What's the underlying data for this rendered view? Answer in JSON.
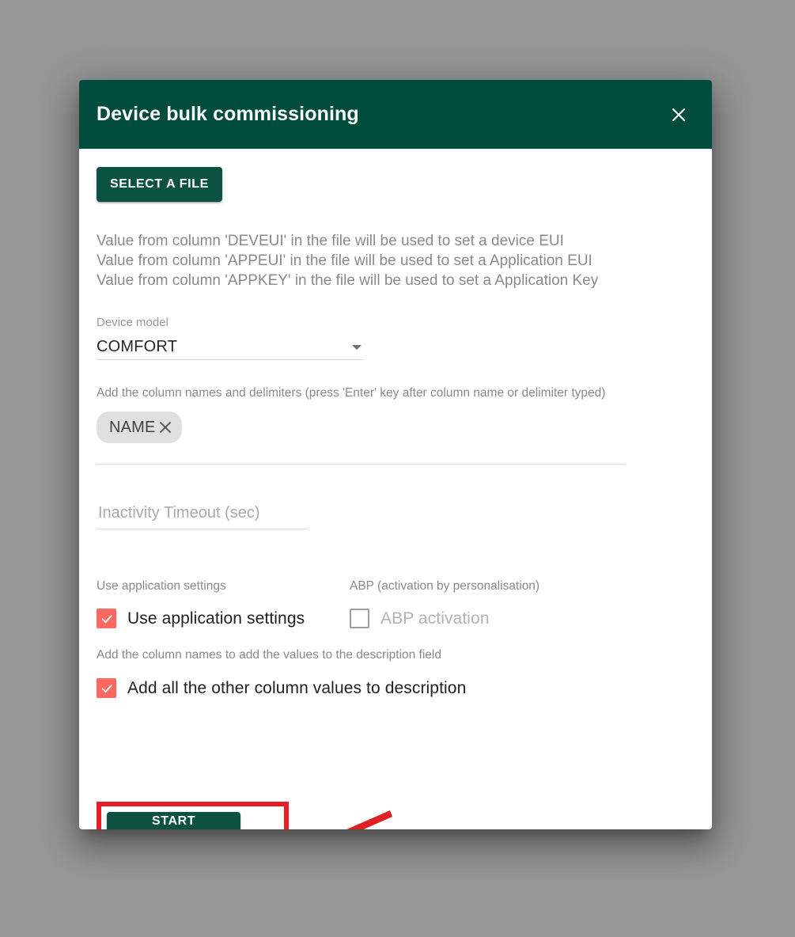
{
  "dialog": {
    "title": "Device bulk commissioning",
    "close_icon": "close-icon"
  },
  "file": {
    "select_button_label": "SELECT A FILE"
  },
  "info_lines": [
    "Value from column 'DEVEUI' in the file will be used to set a device EUI",
    "Value from column 'APPEUI' in the file will be used to set a Application EUI",
    "Value from column 'APPKEY' in the file will be used to set a Application Key"
  ],
  "device_model": {
    "label": "Device model",
    "value": "COMFORT",
    "caret_icon": "chevron-down-icon"
  },
  "columns": {
    "hint": "Add the column names and delimiters (press 'Enter' key after column name or delimiter typed)",
    "chips": [
      {
        "label": "NAME",
        "remove_icon": "close-icon"
      }
    ]
  },
  "inactivity": {
    "placeholder": "Inactivity Timeout (sec)",
    "value": ""
  },
  "options": {
    "use_application_settings_header": "Use application settings",
    "abp_header": "ABP (activation by personalisation)",
    "use_application_settings_label": "Use application settings",
    "use_application_settings_checked": true,
    "abp_label": "ABP activation",
    "abp_checked": false,
    "abp_disabled": true,
    "description_hint": "Add the column names to add the values to the description field",
    "description_label": "Add all the other column values to description",
    "description_checked": true
  },
  "actions": {
    "start_commissioning_label": "START COMMISSIONING"
  },
  "annotation": {
    "highlight_color": "#e81e26",
    "arrow_color": "#e02020"
  },
  "colors": {
    "header_green": "#004d3d",
    "button_green": "#0b5243",
    "checkbox_red": "#fa6a62",
    "backdrop_gray": "#969696",
    "chip_gray": "#e0e0e0"
  }
}
